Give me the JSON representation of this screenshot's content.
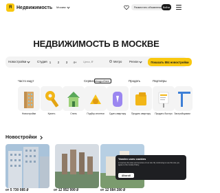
{
  "header": {
    "logo_badge": "Я",
    "logo_text": "Недвижимость",
    "city": "Москва",
    "place_ad": "Разместить объявление",
    "login": "Войти"
  },
  "hero": {
    "title": "НЕДВИЖИМОСТЬ В МОСКВЕ"
  },
  "search": {
    "type": "Новостройки",
    "rooms_label": "Студия",
    "rooms": [
      "1",
      "2",
      "3",
      "4+"
    ],
    "price": "Цена, ₽",
    "metro": "Метро",
    "region": "Регион",
    "show_button": "Показать 804 новостройки"
  },
  "categories": {
    "buy": "Часто ищут",
    "services": "Сервисы",
    "services_badge": "подробнее",
    "sell": "Продать",
    "partners": "Партнёры"
  },
  "tiles": [
    {
      "label": "Новостройки"
    },
    {
      "label": "Купить"
    },
    {
      "label": "Снять"
    },
    {
      "label": "Подбор ипотеки"
    },
    {
      "label": "Сдать квартиру"
    },
    {
      "label": "Продать квартиру"
    },
    {
      "label": "Продать быстро"
    },
    {
      "label": "Застройщикам"
    }
  ],
  "newbuilds": {
    "title": "Новостройки",
    "cards": [
      {
        "price": "от 5 730 085 ₽"
      },
      {
        "price": "от 12 952 999 ₽"
      },
      {
        "price": "от 12 084 280 ₽"
      }
    ]
  },
  "cookie": {
    "title": "Yandex uses cookies",
    "text": "to improve the sites and services of our site. By continuing to use this site you agree to the Cookie Policy.",
    "button": "Allow all"
  },
  "colors": {
    "accent": "#f9c80e",
    "dark": "#1a1a1a"
  }
}
